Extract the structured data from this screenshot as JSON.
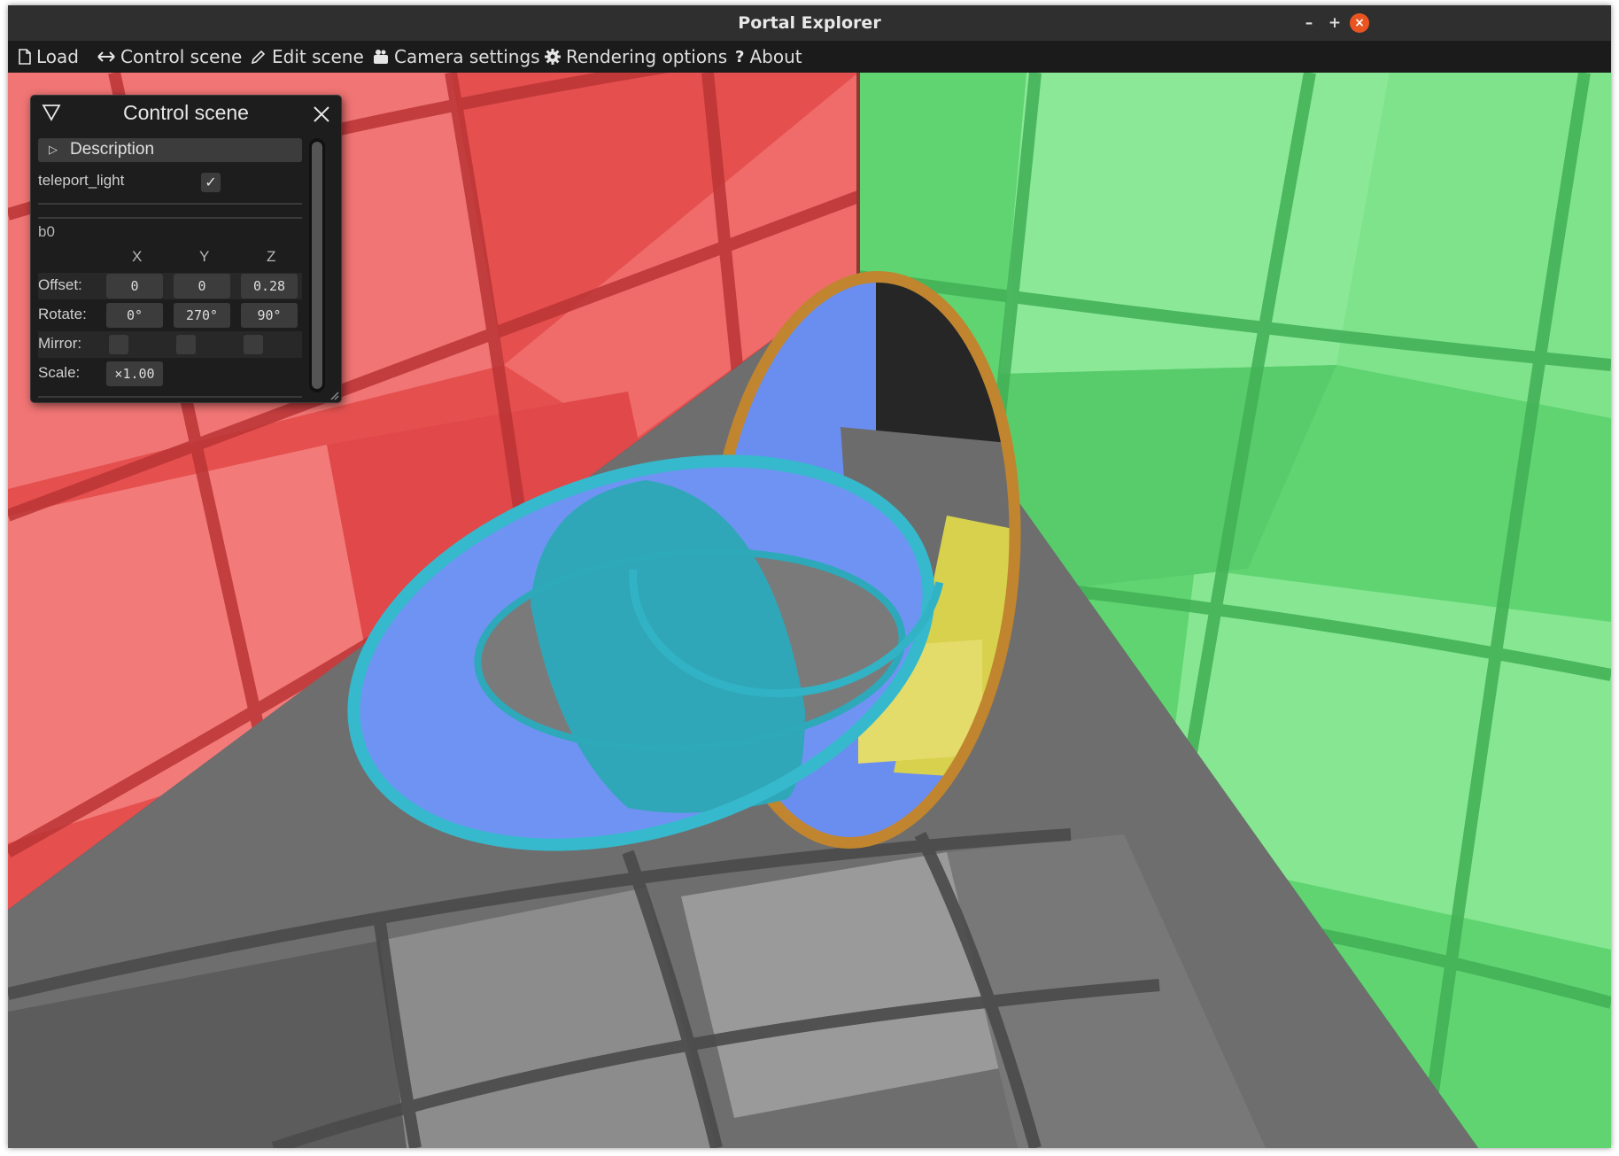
{
  "window": {
    "title": "Portal Explorer",
    "minimize_glyph": "–",
    "maximize_glyph": "+",
    "close_glyph": "×"
  },
  "menu": [
    {
      "label": "Load",
      "icon": "file-icon"
    },
    {
      "label": "Control scene",
      "icon": "arrows-horizontal-icon"
    },
    {
      "label": "Edit scene",
      "icon": "pencil-icon"
    },
    {
      "label": "Camera settings",
      "icon": "camera-icon"
    },
    {
      "label": "Rendering options",
      "icon": "gear-icon"
    },
    {
      "label": "About",
      "icon": "question-icon"
    }
  ],
  "panel": {
    "title": "Control scene",
    "description_label": "Description",
    "teleport_light": {
      "label": "teleport_light",
      "checked": true
    },
    "object_name": "b0",
    "axes": [
      "X",
      "Y",
      "Z"
    ],
    "offset": {
      "label": "Offset:",
      "values": [
        "0",
        "0",
        "0.28"
      ]
    },
    "rotate": {
      "label": "Rotate:",
      "values": [
        "0°",
        "270°",
        "90°"
      ]
    },
    "mirror": {
      "label": "Mirror:",
      "values": [
        false,
        false,
        false
      ]
    },
    "scale": {
      "label": "Scale:",
      "value": "×1.00"
    }
  },
  "scene": {
    "colors": {
      "red_wall": "#ee5555",
      "green_wall": "#66d97a",
      "floor": "#7a7a7a",
      "portal_blue": "#6a8ef0",
      "ring_teal": "#2fb4c8",
      "ring_orange": "#c0852e",
      "yellow": "#d8d14e"
    }
  },
  "colors": {
    "titlebar_bg": "#2f2f2f",
    "menubar_bg": "#1b1b1b",
    "panel_bg": "#1d1d1d",
    "close_button": "#e95420"
  }
}
